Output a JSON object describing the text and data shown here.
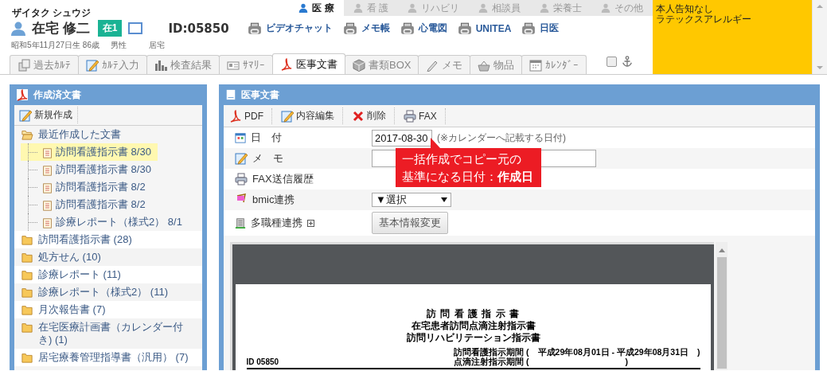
{
  "patient": {
    "kana": "ザイタク シュウジ",
    "name": "在宅 修二",
    "badge": "在1",
    "id": "ID:05850",
    "birth": "昭和5年11月27日生 86歳",
    "sex": "男性",
    "residence": "居宅"
  },
  "links": [
    "ビデオチャット",
    "メモ帳",
    "心電図",
    "UNITEA",
    "日医"
  ],
  "roles": [
    {
      "label": "医 療",
      "selected": true
    },
    {
      "label": "看 護",
      "selected": false
    },
    {
      "label": "リハビリ",
      "selected": false
    },
    {
      "label": "相談員",
      "selected": false
    },
    {
      "label": "栄養士",
      "selected": false
    },
    {
      "label": "その他",
      "selected": false
    }
  ],
  "alert": {
    "lines": [
      "本人告知なし",
      "ラテックスアレルギー"
    ]
  },
  "tabs": [
    {
      "kind": "history",
      "label": "過去ｶﾙﾃ",
      "selected": false
    },
    {
      "kind": "edit",
      "label": "ｶﾙﾃ入力",
      "selected": false
    },
    {
      "kind": "chart",
      "label": "検査結果",
      "selected": false
    },
    {
      "kind": "card",
      "label": "ｻﾏﾘｰ",
      "selected": false
    },
    {
      "kind": "pdf",
      "label": "医事文書",
      "selected": true
    },
    {
      "kind": "box",
      "label": "書類BOX",
      "selected": false
    },
    {
      "kind": "pen",
      "label": "メモ",
      "selected": false
    },
    {
      "kind": "basket",
      "label": "物品",
      "selected": false
    },
    {
      "kind": "calendar",
      "label": "ｶﾚﾝﾀﾞｰ",
      "selected": false
    }
  ],
  "pin_checkbox": {
    "checked": false
  },
  "sidebar": {
    "title": "作成済文書",
    "new_button": "新規作成",
    "recent": {
      "label": "最近作成した文書",
      "expanded": true,
      "children": [
        {
          "label": "訪問看護指示書 8/30",
          "selected": true
        },
        {
          "label": "訪問看護指示書 8/30",
          "selected": false
        },
        {
          "label": "訪問看護指示書 8/2",
          "selected": false
        },
        {
          "label": "訪問看護指示書 8/2",
          "selected": false
        },
        {
          "label": "診療レポート（様式2） 8/1",
          "selected": false
        }
      ]
    },
    "folders": [
      "訪問看護指示書 (28)",
      "処方せん (10)",
      "診療レポート (11)",
      "診療レポート（様式2） (11)",
      "月次報告書 (7)",
      "在宅医療計画書（カレンダー付き) (1)",
      "居宅療養管理指導書（汎用） (7)"
    ]
  },
  "document": {
    "title": "医事文書",
    "toolbar": [
      {
        "kind": "pdf",
        "label": "PDF"
      },
      {
        "kind": "edit",
        "label": "内容編集"
      },
      {
        "kind": "delete",
        "label": "削除"
      },
      {
        "kind": "fax",
        "label": "FAX"
      }
    ],
    "fields": [
      {
        "kind": "date",
        "label": "日　付",
        "value": "2017-08-30",
        "note": "(※カレンダーへ記載する日付)"
      },
      {
        "kind": "memo",
        "label": "メ　モ"
      },
      {
        "kind": "fax",
        "label": "FAX送信履歴"
      },
      {
        "kind": "select",
        "label": "bmic連携",
        "value": "▼選択"
      },
      {
        "kind": "multi",
        "label": "多職種連携",
        "button": "基本情報変更"
      }
    ],
    "tooltip": [
      "一括作成でコピー元の",
      "基準になる日付：**作成日**"
    ],
    "preview": {
      "titles": [
        "訪 問 看 護 指 示 書",
        "在宅患者訪問点滴注射指示書",
        "訪問リハビリテーション指示書"
      ],
      "id": "ID 05850",
      "periods": [
        "訪問看護指示期間 (　平成29年08月01日 - 平成29年08月31日　)",
        "点滴注射指示期間 (　　　　　　　　　　　)"
      ]
    }
  }
}
